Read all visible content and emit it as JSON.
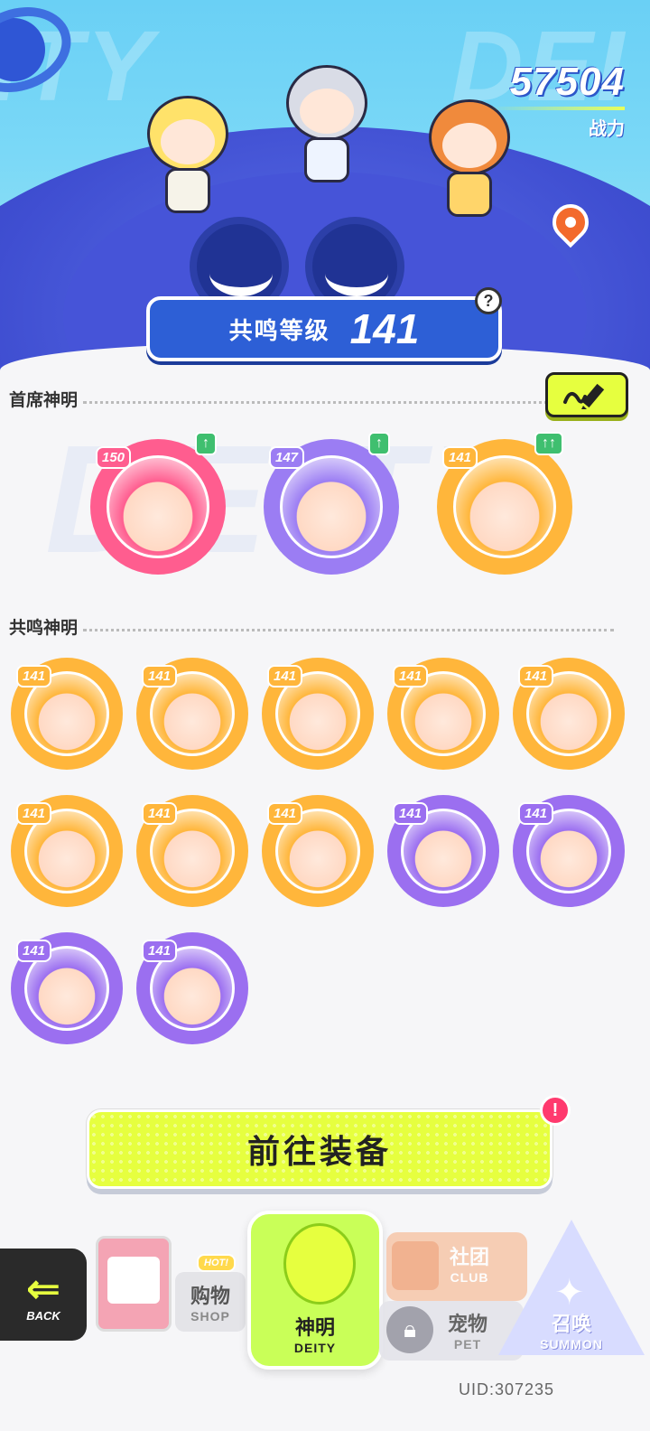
{
  "header": {
    "bg_text_left": "ITY",
    "bg_text_right": "DEI",
    "power_value": "57504",
    "power_label": "战力",
    "resonance_label": "共鸣等级",
    "resonance_level": "141",
    "help_icon": "question-mark-icon"
  },
  "sections": {
    "leader_title": "首席神明",
    "resonance_title": "共鸣神明",
    "watermark": "DEITY"
  },
  "leader_deities": [
    {
      "level": "150",
      "theme": "#ff5d8f",
      "upgrade": "↑"
    },
    {
      "level": "147",
      "theme": "#9b7df3",
      "upgrade": "↑"
    },
    {
      "level": "141",
      "theme": "#ffb63b",
      "upgrade": "↑↑"
    }
  ],
  "resonance_deities": [
    {
      "level": "141",
      "theme": "#ffb63b"
    },
    {
      "level": "141",
      "theme": "#ffb63b"
    },
    {
      "level": "141",
      "theme": "#ffb63b"
    },
    {
      "level": "141",
      "theme": "#ffb63b"
    },
    {
      "level": "141",
      "theme": "#ffb63b"
    },
    {
      "level": "141",
      "theme": "#ffb63b"
    },
    {
      "level": "141",
      "theme": "#ffb63b"
    },
    {
      "level": "141",
      "theme": "#ffb63b"
    },
    {
      "level": "141",
      "theme": "#9b6ff0"
    },
    {
      "level": "141",
      "theme": "#9b6ff0"
    },
    {
      "level": "141",
      "theme": "#9b6ff0"
    },
    {
      "level": "141",
      "theme": "#9b6ff0"
    }
  ],
  "equip_button": "前往装备",
  "alert_badge": "!",
  "nav": {
    "back_en": "BACK",
    "shop_cn": "购物",
    "shop_en": "SHOP",
    "shop_hot": "HOT!",
    "deity_cn": "神明",
    "deity_en": "DEITY",
    "club_cn": "社团",
    "club_en": "CLUB",
    "pet_cn": "宠物",
    "pet_en": "PET",
    "summon_cn": "召唤",
    "summon_en": "SUMMON"
  },
  "uid": "UID:307235",
  "colors": {
    "accent_yellow": "#e6ff3f",
    "primary_blue": "#2d5fd6",
    "gold_frame": "#ffb63b",
    "purple_frame": "#9b6ff0",
    "pink_frame": "#ff5d8f"
  }
}
